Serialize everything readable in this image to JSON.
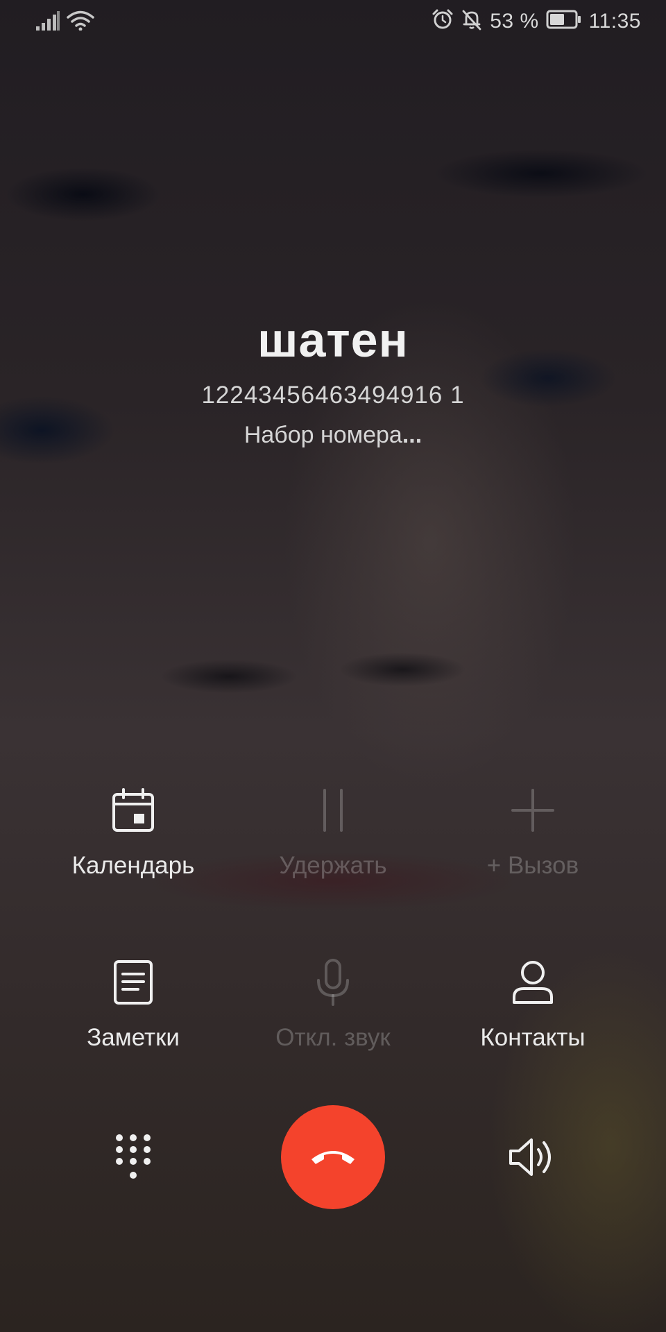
{
  "status_bar": {
    "battery_percent": "53 %",
    "time": "11:35",
    "icons": [
      "signal-icon",
      "wifi-icon",
      "alarm-icon",
      "bell-off-icon",
      "battery-icon"
    ]
  },
  "caller": {
    "name": "шатен",
    "number": "12243456463494916 1",
    "status": "Набор номера",
    "status_dots": "..."
  },
  "actions": {
    "calendar": {
      "label": "Календарь",
      "icon": "calendar-icon"
    },
    "hold": {
      "label": "Удержать",
      "icon": "pause-icon"
    },
    "add_call": {
      "label": "+ Вызов",
      "icon": "plus-icon"
    },
    "notes": {
      "label": "Заметки",
      "icon": "notes-icon"
    },
    "mute": {
      "label": "Откл. звук",
      "icon": "microphone-icon"
    },
    "contacts": {
      "label": "Контакты",
      "icon": "contact-icon"
    }
  },
  "bottom": {
    "dialpad": "dialpad-icon",
    "end_call": "end-call-icon",
    "speaker": "speaker-icon"
  },
  "colors": {
    "end_call": "#f4432c"
  }
}
